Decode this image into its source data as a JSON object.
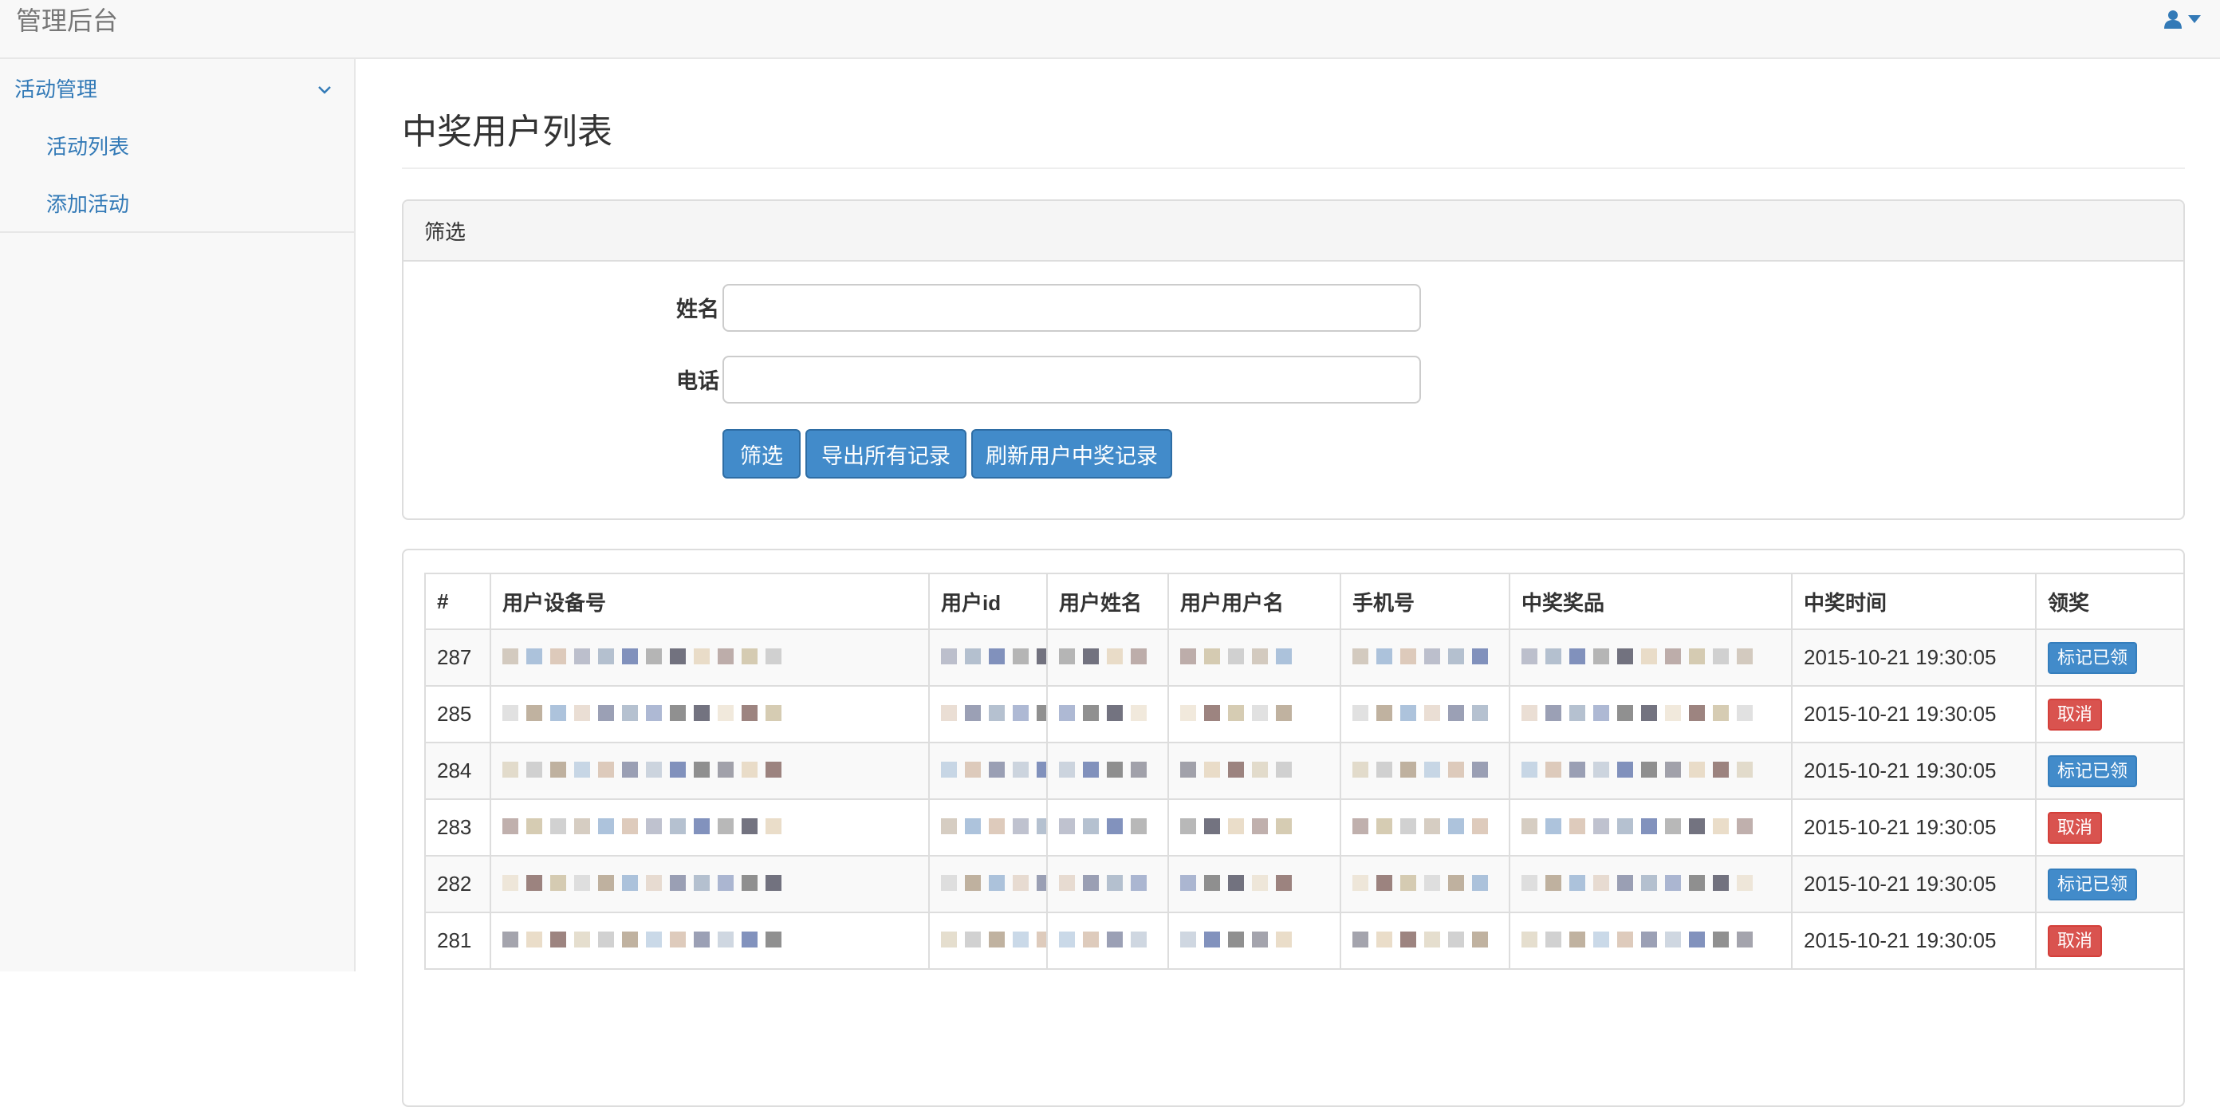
{
  "app": {
    "title": "管理后台"
  },
  "sidebar": {
    "group_label": "活动管理",
    "items": [
      {
        "label": "活动列表"
      },
      {
        "label": "添加活动"
      }
    ]
  },
  "page": {
    "title": "中奖用户列表"
  },
  "filter": {
    "heading": "筛选",
    "name_label": "姓名",
    "phone_label": "电话",
    "name_value": "",
    "phone_value": "",
    "buttons": {
      "filter": "筛选",
      "export": "导出所有记录",
      "refresh": "刷新用户中奖记录"
    }
  },
  "table": {
    "columns": [
      "#",
      "用户设备号",
      "用户id",
      "用户姓名",
      "用户用户名",
      "手机号",
      "中奖奖品",
      "中奖时间",
      "领奖"
    ],
    "rows": [
      {
        "id": "287",
        "time": "2015-10-21 19:30:05",
        "action": "标记已领",
        "action_type": "mark"
      },
      {
        "id": "285",
        "time": "2015-10-21 19:30:05",
        "action": "取消",
        "action_type": "cancel"
      },
      {
        "id": "284",
        "time": "2015-10-21 19:30:05",
        "action": "标记已领",
        "action_type": "mark"
      },
      {
        "id": "283",
        "time": "2015-10-21 19:30:05",
        "action": "取消",
        "action_type": "cancel"
      },
      {
        "id": "282",
        "time": "2015-10-21 19:30:05",
        "action": "标记已领",
        "action_type": "mark"
      },
      {
        "id": "281",
        "time": "2015-10-21 19:30:05",
        "action": "取消",
        "action_type": "cancel"
      }
    ]
  },
  "colors": {
    "link": "#337ab7",
    "primary": "#428bca",
    "danger": "#d9534f",
    "navbar_bg": "#f8f8f8"
  },
  "icons": {
    "user": "user-icon",
    "caret": "caret-down-icon",
    "chevron": "chevron-down-icon"
  }
}
